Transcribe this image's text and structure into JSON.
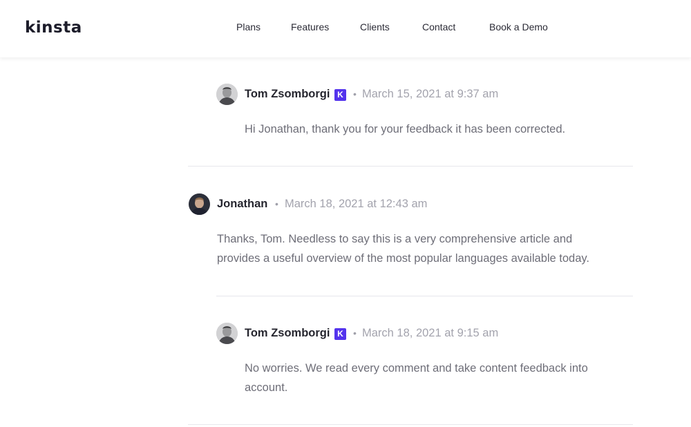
{
  "header": {
    "logo": "kinsta",
    "nav": [
      {
        "label": "Plans"
      },
      {
        "label": "Features"
      },
      {
        "label": "Clients"
      },
      {
        "label": "Contact"
      },
      {
        "label": "Book a Demo"
      }
    ]
  },
  "comments": [
    {
      "author": "Tom Zsomborgi",
      "badge": "K",
      "date": "March 15, 2021 at 9:37 am",
      "lines": [
        "Hi Jonathan, thank you for your feedback it has been corrected."
      ]
    },
    {
      "author": "Jonathan",
      "date": "March 18, 2021 at 12:43 am",
      "lines": [
        "Thanks, Tom. Needless to say this is a very comprehensive article and",
        "provides a useful overview of the most popular languages available today."
      ]
    },
    {
      "author": "Tom Zsomborgi",
      "badge": "K",
      "date": "March 18, 2021 at 9:15 am",
      "lines": [
        "No worries. We read every comment and take content feedback into",
        "account."
      ]
    }
  ],
  "separator": "•",
  "colors": {
    "badge": "#5333ed",
    "author": "#26262f",
    "date": "#a3a3ad",
    "body": "#6e6e78"
  }
}
